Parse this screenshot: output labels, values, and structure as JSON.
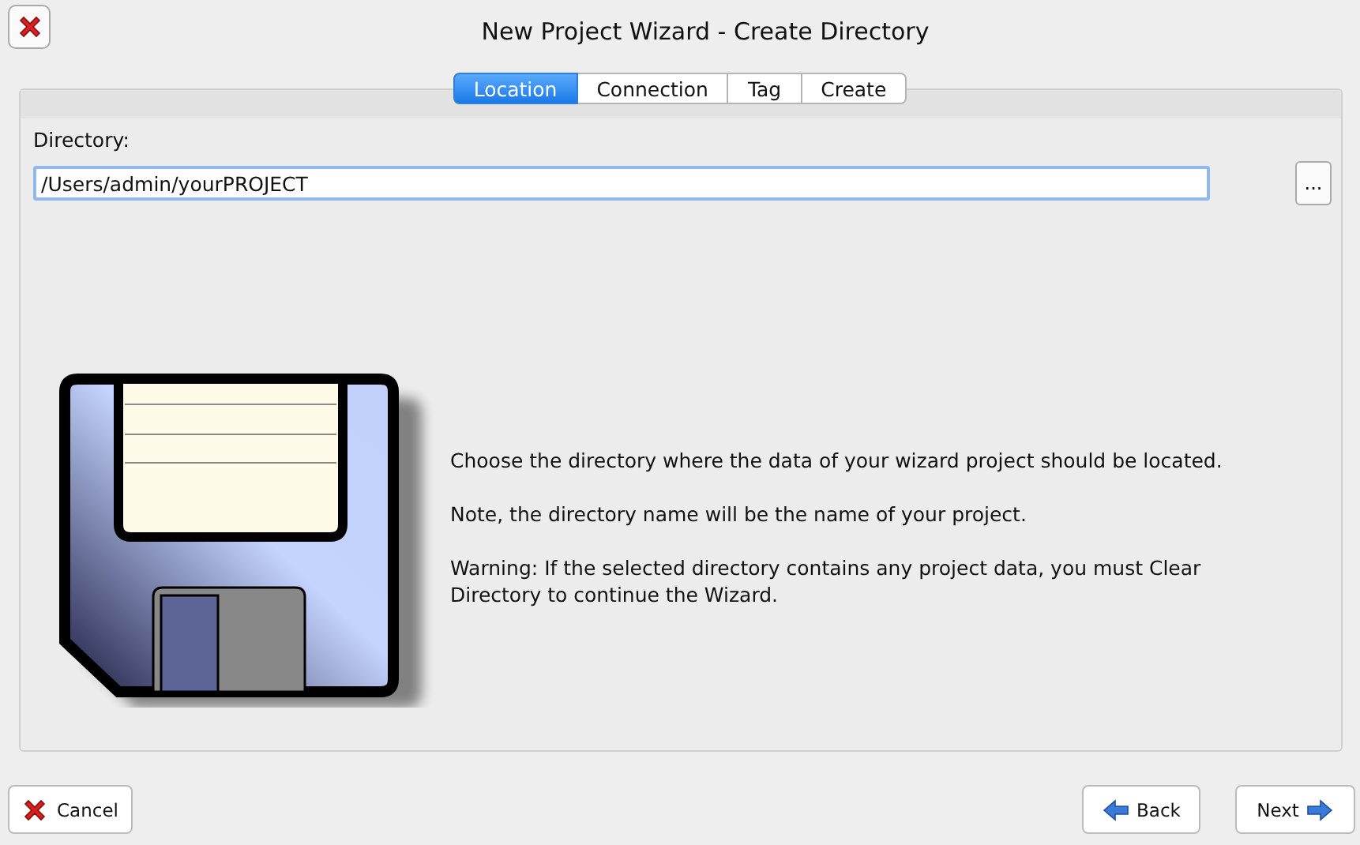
{
  "window": {
    "title": "New Project Wizard - Create Directory"
  },
  "tabs": [
    {
      "label": "Location",
      "selected": true
    },
    {
      "label": "Connection",
      "selected": false
    },
    {
      "label": "Tag",
      "selected": false
    },
    {
      "label": "Create",
      "selected": false
    }
  ],
  "directory": {
    "label": "Directory:",
    "value": "/Users/admin/yourPROJECT",
    "browse_label": "..."
  },
  "description": [
    "Choose the directory where the data of your wizard project should be located.",
    "Note, the directory name will be the name of your project.",
    "Warning: If the selected directory contains any project data, you must Clear Directory to continue the Wizard."
  ],
  "buttons": [
    {
      "kind": "cancel",
      "label": "Cancel"
    },
    {
      "kind": "back",
      "label": "Back"
    },
    {
      "kind": "next",
      "label": "Next"
    }
  ]
}
